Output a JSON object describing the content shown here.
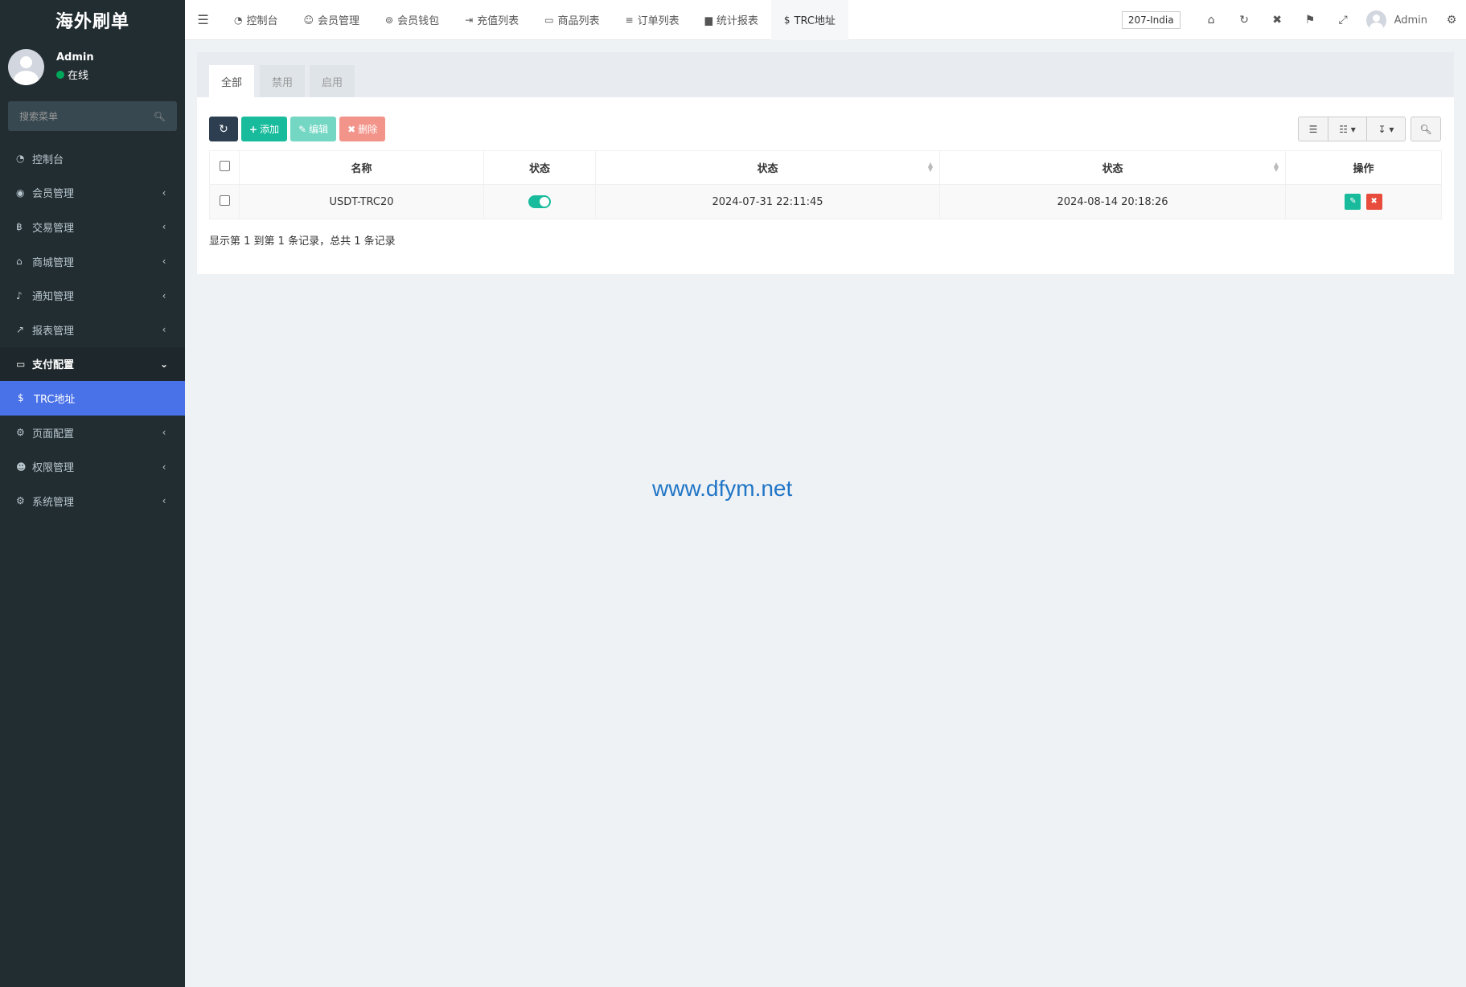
{
  "sidebar": {
    "logo": "海外刷单",
    "user": {
      "name": "Admin",
      "status": "在线"
    },
    "search": {
      "placeholder": "搜索菜单"
    },
    "items": [
      {
        "label": "控制台",
        "icon": "dashboard-icon"
      },
      {
        "label": "会员管理",
        "icon": "user-circle-icon"
      },
      {
        "label": "交易管理",
        "icon": "bitcoin-icon"
      },
      {
        "label": "商城管理",
        "icon": "home-icon"
      },
      {
        "label": "通知管理",
        "icon": "bell-icon"
      },
      {
        "label": "报表管理",
        "icon": "line-chart-icon"
      },
      {
        "label": "支付配置",
        "icon": "credit-card-icon"
      },
      {
        "label": "TRC地址",
        "icon": "dollar-icon"
      },
      {
        "label": "页面配置",
        "icon": "gear-icon"
      },
      {
        "label": "权限管理",
        "icon": "users-icon"
      },
      {
        "label": "系统管理",
        "icon": "cogs-icon"
      }
    ]
  },
  "topnav": {
    "tabs": [
      {
        "label": "控制台",
        "icon": "dashboard-icon"
      },
      {
        "label": "会员管理",
        "icon": "user-icon"
      },
      {
        "label": "会员钱包",
        "icon": "wallet-icon"
      },
      {
        "label": "充值列表",
        "icon": "sign-in-icon"
      },
      {
        "label": "商品列表",
        "icon": "desktop-icon"
      },
      {
        "label": "订单列表",
        "icon": "list-icon"
      },
      {
        "label": "统计报表",
        "icon": "bar-chart-icon"
      },
      {
        "label": "TRC地址",
        "icon": "dollar-icon"
      }
    ],
    "site_badge": "207-India",
    "username": "Admin"
  },
  "subtabs": [
    "全部",
    "禁用",
    "启用"
  ],
  "toolbar": {
    "add_label": "添加",
    "edit_label": "编辑",
    "delete_label": "删除"
  },
  "table": {
    "headers": [
      "名称",
      "状态",
      "状态",
      "状态",
      "操作"
    ],
    "rows": [
      {
        "name": "USDT-TRC20",
        "status_on": true,
        "created": "2024-07-31 22:11:45",
        "updated": "2024-08-14 20:18:26"
      }
    ]
  },
  "pager_info": "显示第 1 到第 1 条记录，总共 1 条记录",
  "watermark": "www.dfym.net",
  "colors": {
    "sidebar_bg": "#222d32",
    "active_item": "#4a72e8",
    "success": "#18bc9c",
    "danger": "#e74c3c",
    "primary_dark": "#2c3e50"
  }
}
